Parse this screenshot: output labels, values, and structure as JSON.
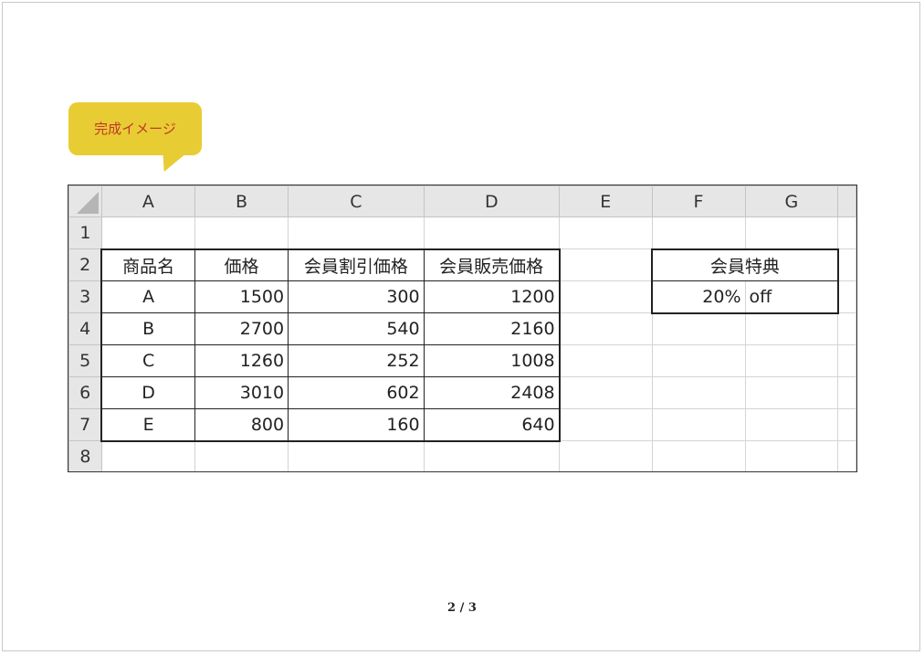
{
  "callout": {
    "text": "完成イメージ"
  },
  "sheet": {
    "columns": [
      "A",
      "B",
      "C",
      "D",
      "E",
      "F",
      "G"
    ],
    "row_numbers": [
      "1",
      "2",
      "3",
      "4",
      "5",
      "6",
      "7",
      "8"
    ],
    "headers": [
      "商品名",
      "価格",
      "会員割引価格",
      "会員販売価格"
    ],
    "rows": [
      [
        "A",
        "1500",
        "300",
        "1200"
      ],
      [
        "B",
        "2700",
        "540",
        "2160"
      ],
      [
        "C",
        "1260",
        "252",
        "1008"
      ],
      [
        "D",
        "3010",
        "602",
        "2408"
      ],
      [
        "E",
        "800",
        "160",
        "640"
      ]
    ],
    "benefit": {
      "title": "会員特典",
      "value": "20%",
      "unit": "off"
    }
  },
  "footer": {
    "page": "2 / 3"
  }
}
